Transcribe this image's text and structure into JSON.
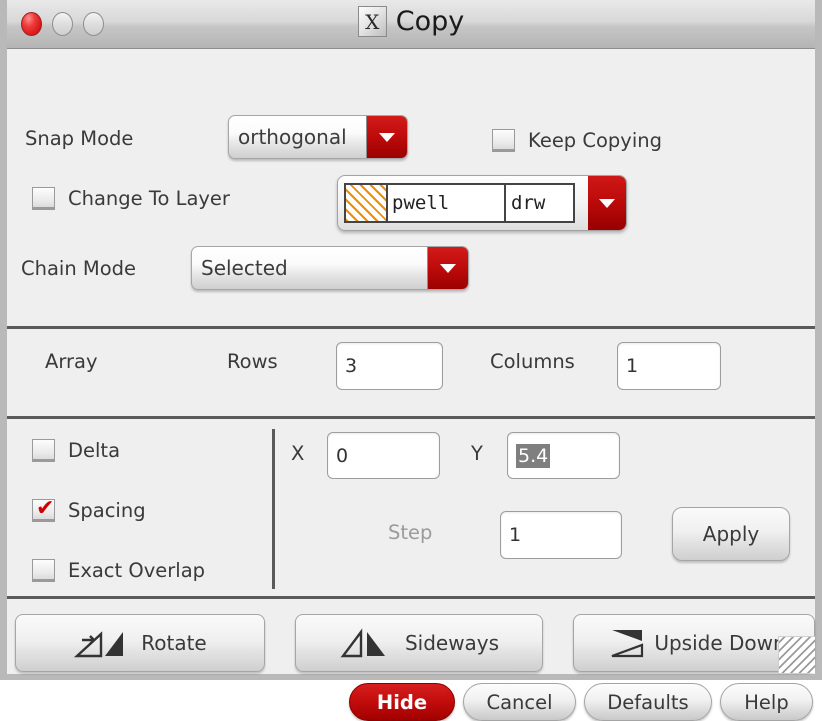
{
  "window": {
    "title": "Copy",
    "x11_glyph": "X",
    "traffic_lights": [
      "close",
      "minimize",
      "zoom"
    ],
    "accent_red": "#c00c0c",
    "background": "#efefef"
  },
  "snap": {
    "label": "Snap Mode",
    "value": "orthogonal"
  },
  "keep_copying": {
    "label": "Keep Copying",
    "checked": false
  },
  "change_to_layer": {
    "label": "Change To Layer",
    "checked": false,
    "layer_name": "pwell",
    "layer_purpose": "drw",
    "swatch_color": "#f08c00"
  },
  "chain": {
    "label": "Chain Mode",
    "value": "Selected"
  },
  "array": {
    "label": "Array",
    "rows_label": "Rows",
    "rows_value": "3",
    "columns_label": "Columns",
    "columns_value": "1"
  },
  "offset": {
    "delta_label": "Delta",
    "delta_checked": false,
    "spacing_label": "Spacing",
    "spacing_checked": true,
    "exact_overlap_label": "Exact Overlap",
    "exact_overlap_checked": false,
    "x_label": "X",
    "x_value": "0",
    "y_label": "Y",
    "y_value": "5.4",
    "y_selected": true,
    "step_label": "Step",
    "step_value": "1",
    "step_enabled": false,
    "apply_label": "Apply"
  },
  "transform": {
    "rotate_label": "Rotate",
    "sideways_label": "Sideways",
    "upside_down_label": "Upside Down"
  },
  "footer": {
    "hide_label": "Hide",
    "cancel_label": "Cancel",
    "defaults_label": "Defaults",
    "help_label": "Help"
  }
}
